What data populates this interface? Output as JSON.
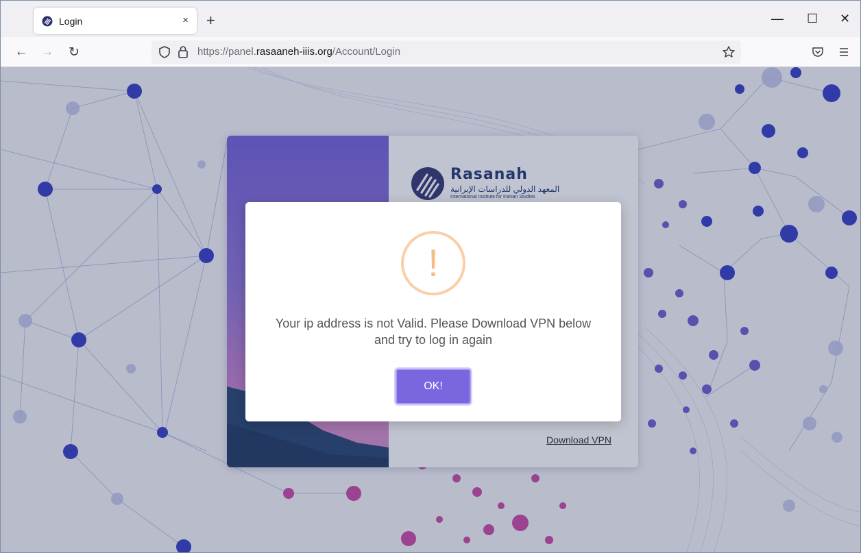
{
  "browser": {
    "tab": {
      "title": "Login",
      "close_label": "×",
      "favicon": "rasanah-icon"
    },
    "new_tab_label": "+",
    "window_controls": {
      "minimize": "—",
      "maximize": "☐",
      "close": "✕"
    },
    "nav": {
      "back": "←",
      "forward": "→",
      "reload": "↻"
    },
    "url": {
      "prefix": "https://panel.",
      "domain": "rasaaneh-iiis.org",
      "path": "/Account/Login"
    }
  },
  "login_card": {
    "logo_text": "Rasanah",
    "logo_arabic": "المعهد الدولي للدراسات الإيرانية",
    "logo_subtitle": "International Institute for Iranian Studies",
    "download_vpn_link": "Download VPN"
  },
  "modal": {
    "icon": "warning-icon",
    "icon_glyph": "!",
    "message": "Your ip address is not Valid. Please Download VPN below and try to log in again",
    "button_label": "OK!"
  },
  "colors": {
    "accent": "#7a67e0",
    "warning": "#f8bb86",
    "brand": "#1b2e6e"
  }
}
